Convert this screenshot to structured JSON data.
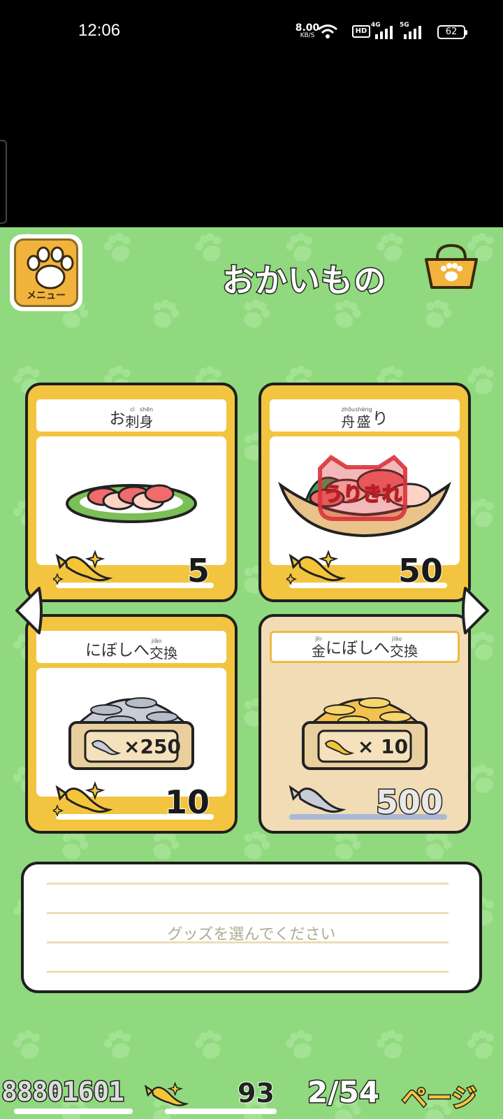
{
  "status_bar": {
    "time": "12:06",
    "net_speed_value": "8.00",
    "net_speed_unit": "KB/S",
    "hd_badge": "HD",
    "network_1": "4G",
    "network_2": "5G",
    "battery": "62",
    "icons": [
      "wifi-icon",
      "signal-icon",
      "battery-icon"
    ]
  },
  "header": {
    "menu_label": "メニュー",
    "title": "おかいもの",
    "icons": [
      "paw-icon",
      "shopping-bag-icon"
    ]
  },
  "shop_items": [
    {
      "name_prefix": "お",
      "kanji": [
        {
          "ruby": "cì",
          "char": "刺"
        },
        {
          "ruby": "shēn",
          "char": "身"
        }
      ],
      "name_suffix": "",
      "price": "5",
      "currency": "gold-fish-icon",
      "sold_out": false
    },
    {
      "name_prefix": "",
      "kanji": [
        {
          "ruby": "zhōu",
          "char": "舟"
        },
        {
          "ruby": "shèng",
          "char": "盛"
        }
      ],
      "name_suffix": "り",
      "price": "50",
      "currency": "gold-fish-icon",
      "sold_out": true,
      "sold_out_stamp": "うりきれ"
    },
    {
      "name_prefix": "にぼしへ",
      "kanji": [
        {
          "ruby": "jiāo",
          "char": "交"
        },
        {
          "ruby": "",
          "char": "換"
        }
      ],
      "name_suffix": "",
      "box_quantity": "×250",
      "price": "10",
      "currency": "gold-fish-icon",
      "sold_out": false
    },
    {
      "name_prefix": "",
      "kanji": [
        {
          "ruby": "jīn",
          "char": "金"
        }
      ],
      "name_middle": "にぼしへ",
      "kanji2": [
        {
          "ruby": "jiāo",
          "char": "交"
        },
        {
          "ruby": "",
          "char": "換"
        }
      ],
      "box_quantity": "× 10",
      "price": "500",
      "currency": "silver-fish-icon",
      "sold_out": false
    }
  ],
  "message": "グッズを選んでください",
  "bottom_bar": {
    "silver_fish": "88801601",
    "gold_fish": "93",
    "page": "2/54",
    "page_label": "ページ"
  },
  "colors": {
    "background_green": "#90d97e",
    "card_yellow": "#f3c43f",
    "card_tan": "#f1dcb6",
    "sold_out_red": "#d9343a"
  }
}
